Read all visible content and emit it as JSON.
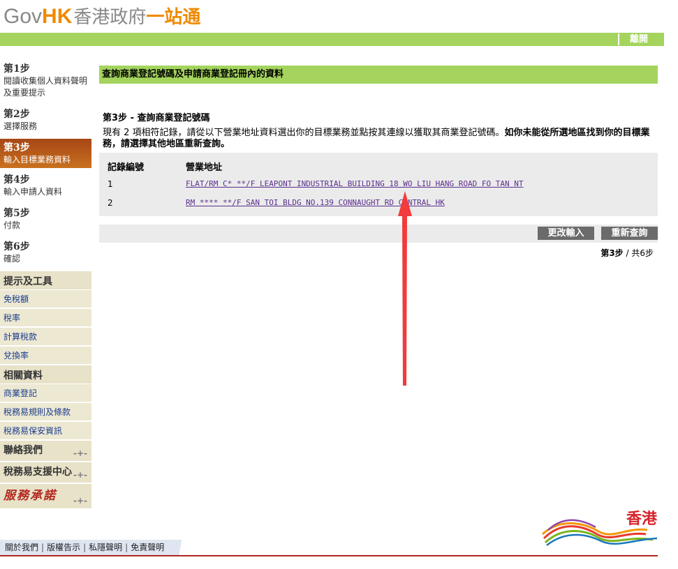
{
  "header": {
    "logo_gov": "Gov",
    "logo_hk": "HK",
    "logo_zh1": "香港政府",
    "logo_zh2": "一站通",
    "leave_label": "離開"
  },
  "sidebar": {
    "steps": [
      {
        "title": "第1步",
        "desc": "閱讀收集個人資料聲明及重要提示"
      },
      {
        "title": "第2步",
        "desc": "選擇服務"
      },
      {
        "title": "第3步",
        "desc": "輸入目標業務資料"
      },
      {
        "title": "第4步",
        "desc": "輸入申請人資料"
      },
      {
        "title": "第5步",
        "desc": "付款"
      },
      {
        "title": "第6步",
        "desc": "確認"
      }
    ],
    "tips_heading": "提示及工具",
    "tips": [
      "免稅額",
      "稅率",
      "計算稅款",
      "兌換率"
    ],
    "related_heading": "相關資料",
    "related": [
      "商業登記",
      "稅務易規則及條款",
      "稅務易保安資訊"
    ],
    "contact": "聯絡我們",
    "support": "稅務易支援中心",
    "service": "服務承諾",
    "colors": {
      "active_step": "#b05a1a",
      "panel": "#e7e2c8"
    }
  },
  "main": {
    "page_title": "查詢商業登記號碼及申請商業登記冊內的資料",
    "step_title": "第3步 - 查詢商業登記號碼",
    "instruction_plain": "現有 2 項相符記錄，請從以下營業地址資料選出你的目標業務並點按其連線以獲取其商業登記號碼。",
    "instruction_bold": "如你未能從所選地區找到你的目標業務，請選擇其他地區重新查詢。",
    "table": {
      "col_no": "記錄編號",
      "col_addr": "營業地址",
      "rows": [
        {
          "no": "1",
          "addr": "FLAT/RM C* **/F LEAPONT INDUSTRIAL BUILDING 18 WO LIU HANG ROAD FO TAN NT"
        },
        {
          "no": "2",
          "addr": "RM **** **/F SAN TOI BLDG NO.139 CONNAUGHT RD CENTRAL HK"
        }
      ]
    },
    "btn_change": "更改輸入",
    "btn_research": "重新查詢",
    "pager_current": "第3步",
    "pager_total": "/ 共6步"
  },
  "footer": {
    "links": [
      "關於我們",
      "版權告示",
      "私隱聲明",
      "免責聲明"
    ],
    "brand_text": "香港"
  },
  "colors": {
    "green_bar": "#a4d45d",
    "red_arrow": "#f23b3b",
    "button_gray": "#6b6b6b"
  }
}
